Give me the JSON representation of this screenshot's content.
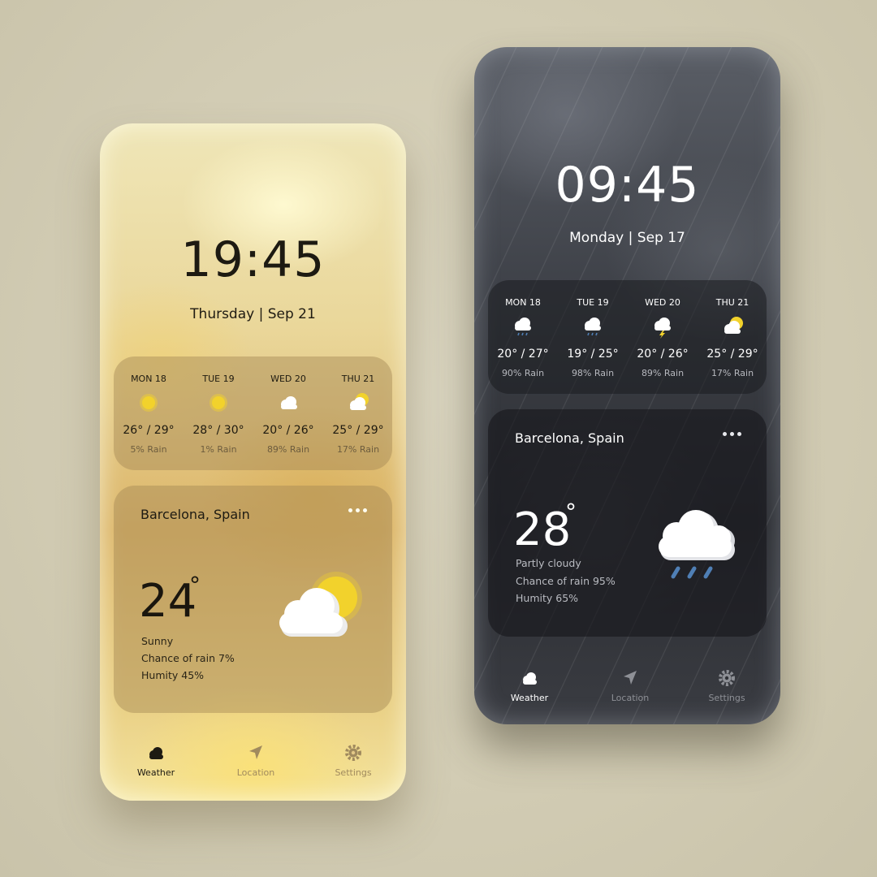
{
  "colors": {
    "background": "#d3cdb6",
    "sun": "#f2d22c",
    "cloud": "#ffffff",
    "rain_drop": "#4f7fb5",
    "light_text": "#1d1a12",
    "dark_text": "#ffffff"
  },
  "light_phone": {
    "time": "19:45",
    "date": "Thursday | Sep 21",
    "forecast": [
      {
        "day": "MON 18",
        "icon": "sun-icon",
        "temp": "26° / 29°",
        "rain": "5% Rain"
      },
      {
        "day": "TUE 19",
        "icon": "sun-icon",
        "temp": "28° / 30°",
        "rain": "1% Rain"
      },
      {
        "day": "WED 20",
        "icon": "cloud-icon",
        "temp": "20° / 26°",
        "rain": "89% Rain"
      },
      {
        "day": "THU 21",
        "icon": "partly-cloudy-icon",
        "temp": "25° / 29°",
        "rain": "17% Rain"
      }
    ],
    "city": "Barcelona, Spain",
    "temp": "24",
    "degree": "°",
    "condition": "Sunny",
    "chance_of_rain": "Chance of rain 7%",
    "humidity": "Humity 45%",
    "nav": {
      "weather": "Weather",
      "location": "Location",
      "settings": "Settings"
    }
  },
  "dark_phone": {
    "time": "09:45",
    "date": "Monday | Sep 17",
    "forecast": [
      {
        "day": "MON 18",
        "icon": "rain-cloud-icon",
        "temp": "20° / 27°",
        "rain": "90% Rain"
      },
      {
        "day": "TUE 19",
        "icon": "rain-cloud-icon",
        "temp": "19° / 25°",
        "rain": "98% Rain"
      },
      {
        "day": "WED 20",
        "icon": "thunder-cloud-icon",
        "temp": "20° / 26°",
        "rain": "89% Rain"
      },
      {
        "day": "THU 21",
        "icon": "partly-cloudy-icon",
        "temp": "25° / 29°",
        "rain": "17% Rain"
      }
    ],
    "city": "Barcelona, Spain",
    "temp": "28",
    "degree": "°",
    "condition": "Partly cloudy",
    "chance_of_rain": "Chance of rain 95%",
    "humidity": "Humity 65%",
    "nav": {
      "weather": "Weather",
      "location": "Location",
      "settings": "Settings"
    }
  }
}
